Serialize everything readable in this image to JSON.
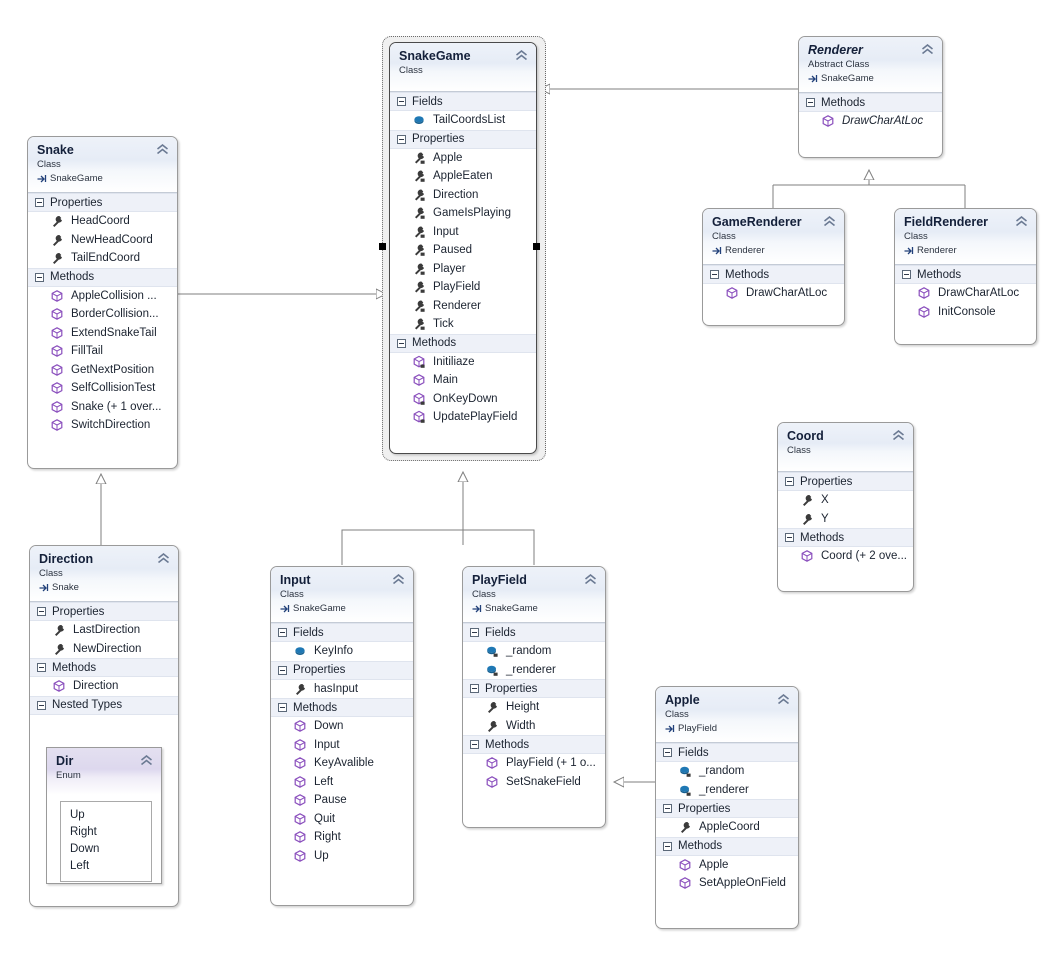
{
  "diagram": {
    "kind_labels": {
      "class": "Class",
      "abstract_class": "Abstract Class",
      "enum": "Enum"
    },
    "groups": {
      "fields": "Fields",
      "properties": "Properties",
      "methods": "Methods",
      "nested_types": "Nested Types"
    },
    "icons": {
      "collapse": "chevron-up-icon",
      "expander": "collapse-box-icon",
      "field": "field-icon",
      "property": "property-icon",
      "method": "method-icon",
      "nesting": "nesting-arrow-icon"
    },
    "colors": {
      "header_gradient_top": "#eef2f9",
      "header_gradient_bottom": "#ffffff",
      "enum_header_top": "#e4e0f0",
      "group_band": "#eef1f8",
      "border": "#9a9a9a",
      "title_text": "#14203a",
      "method_icon": "#8a4fbd",
      "field_icon": "#1f78b4",
      "property_icon": "#3b3b3b",
      "connector": "#7f7f7f"
    }
  },
  "nodes": {
    "snake": {
      "title": "Snake",
      "kind": "Class",
      "parent": "SnakeGame",
      "sections": [
        {
          "label": "Properties",
          "members": [
            {
              "name": "HeadCoord",
              "icon": "property"
            },
            {
              "name": "NewHeadCoord",
              "icon": "property"
            },
            {
              "name": "TailEndCoord",
              "icon": "property"
            }
          ]
        },
        {
          "label": "Methods",
          "members": [
            {
              "name": "AppleCollision ...",
              "icon": "method"
            },
            {
              "name": "BorderCollision...",
              "icon": "method"
            },
            {
              "name": "ExtendSnakeTail",
              "icon": "method"
            },
            {
              "name": "FillTail",
              "icon": "method"
            },
            {
              "name": "GetNextPosition",
              "icon": "method"
            },
            {
              "name": "SelfCollisionTest",
              "icon": "method"
            },
            {
              "name": "Snake (+ 1 over...",
              "icon": "method"
            },
            {
              "name": "SwitchDirection",
              "icon": "method"
            }
          ]
        }
      ]
    },
    "snakegame": {
      "title": "SnakeGame",
      "kind": "Class",
      "parent": "",
      "selected": true,
      "sections": [
        {
          "label": "Fields",
          "members": [
            {
              "name": "TailCoordsList",
              "icon": "field"
            }
          ]
        },
        {
          "label": "Properties",
          "members": [
            {
              "name": "Apple",
              "icon": "property",
              "private": true
            },
            {
              "name": "AppleEaten",
              "icon": "property",
              "private": true
            },
            {
              "name": "Direction",
              "icon": "property",
              "private": true
            },
            {
              "name": "GameIsPlaying",
              "icon": "property",
              "private": true
            },
            {
              "name": "Input",
              "icon": "property",
              "private": true
            },
            {
              "name": "Paused",
              "icon": "property",
              "private": true
            },
            {
              "name": "Player",
              "icon": "property",
              "private": true
            },
            {
              "name": "PlayField",
              "icon": "property",
              "private": true
            },
            {
              "name": "Renderer",
              "icon": "property",
              "private": true
            },
            {
              "name": "Tick",
              "icon": "property",
              "private": true
            }
          ]
        },
        {
          "label": "Methods",
          "members": [
            {
              "name": "Initiliaze",
              "icon": "method",
              "private": true
            },
            {
              "name": "Main",
              "icon": "method"
            },
            {
              "name": "OnKeyDown",
              "icon": "method",
              "private": true
            },
            {
              "name": "UpdatePlayField",
              "icon": "method",
              "private": true
            }
          ]
        }
      ]
    },
    "renderer": {
      "title": "Renderer",
      "kind": "Abstract Class",
      "parent": "SnakeGame",
      "abstract": true,
      "sections": [
        {
          "label": "Methods",
          "members": [
            {
              "name": "DrawCharAtLoc",
              "icon": "method",
              "abstract": true
            }
          ]
        }
      ]
    },
    "gamerenderer": {
      "title": "GameRenderer",
      "kind": "Class",
      "parent": "Renderer",
      "sections": [
        {
          "label": "Methods",
          "members": [
            {
              "name": "DrawCharAtLoc",
              "icon": "method"
            }
          ]
        }
      ]
    },
    "fieldrenderer": {
      "title": "FieldRenderer",
      "kind": "Class",
      "parent": "Renderer",
      "sections": [
        {
          "label": "Methods",
          "members": [
            {
              "name": "DrawCharAtLoc",
              "icon": "method"
            },
            {
              "name": "InitConsole",
              "icon": "method"
            }
          ]
        }
      ]
    },
    "coord": {
      "title": "Coord",
      "kind": "Class",
      "parent": "",
      "sections": [
        {
          "label": "Properties",
          "members": [
            {
              "name": "X",
              "icon": "property"
            },
            {
              "name": "Y",
              "icon": "property"
            }
          ]
        },
        {
          "label": "Methods",
          "members": [
            {
              "name": "Coord (+ 2 ove...",
              "icon": "method"
            }
          ]
        }
      ]
    },
    "direction": {
      "title": "Direction",
      "kind": "Class",
      "parent": "Snake",
      "sections": [
        {
          "label": "Properties",
          "members": [
            {
              "name": "LastDirection",
              "icon": "property"
            },
            {
              "name": "NewDirection",
              "icon": "property"
            }
          ]
        },
        {
          "label": "Methods",
          "members": [
            {
              "name": "Direction",
              "icon": "method"
            }
          ]
        },
        {
          "label": "Nested Types",
          "members": []
        }
      ],
      "nested_enum": {
        "title": "Dir",
        "kind": "Enum",
        "values": [
          "Up",
          "Right",
          "Down",
          "Left"
        ]
      }
    },
    "input": {
      "title": "Input",
      "kind": "Class",
      "parent": "SnakeGame",
      "sections": [
        {
          "label": "Fields",
          "members": [
            {
              "name": "KeyInfo",
              "icon": "field"
            }
          ]
        },
        {
          "label": "Properties",
          "members": [
            {
              "name": "hasInput",
              "icon": "property"
            }
          ]
        },
        {
          "label": "Methods",
          "members": [
            {
              "name": "Down",
              "icon": "method"
            },
            {
              "name": "Input",
              "icon": "method"
            },
            {
              "name": "KeyAvalible",
              "icon": "method"
            },
            {
              "name": "Left",
              "icon": "method"
            },
            {
              "name": "Pause",
              "icon": "method"
            },
            {
              "name": "Quit",
              "icon": "method"
            },
            {
              "name": "Right",
              "icon": "method"
            },
            {
              "name": "Up",
              "icon": "method"
            }
          ]
        }
      ]
    },
    "playfield": {
      "title": "PlayField",
      "kind": "Class",
      "parent": "SnakeGame",
      "sections": [
        {
          "label": "Fields",
          "members": [
            {
              "name": "_random",
              "icon": "field",
              "private": true
            },
            {
              "name": "_renderer",
              "icon": "field",
              "private": true
            }
          ]
        },
        {
          "label": "Properties",
          "members": [
            {
              "name": "Height",
              "icon": "property"
            },
            {
              "name": "Width",
              "icon": "property"
            }
          ]
        },
        {
          "label": "Methods",
          "members": [
            {
              "name": "PlayField (+ 1 o...",
              "icon": "method"
            },
            {
              "name": "SetSnakeField",
              "icon": "method"
            }
          ]
        }
      ]
    },
    "apple": {
      "title": "Apple",
      "kind": "Class",
      "parent": "PlayField",
      "sections": [
        {
          "label": "Fields",
          "members": [
            {
              "name": "_random",
              "icon": "field",
              "private": true
            },
            {
              "name": "_renderer",
              "icon": "field",
              "private": true
            }
          ]
        },
        {
          "label": "Properties",
          "members": [
            {
              "name": "AppleCoord",
              "icon": "property"
            }
          ]
        },
        {
          "label": "Methods",
          "members": [
            {
              "name": "Apple",
              "icon": "method"
            },
            {
              "name": "SetAppleOnField",
              "icon": "method"
            }
          ]
        }
      ]
    }
  }
}
